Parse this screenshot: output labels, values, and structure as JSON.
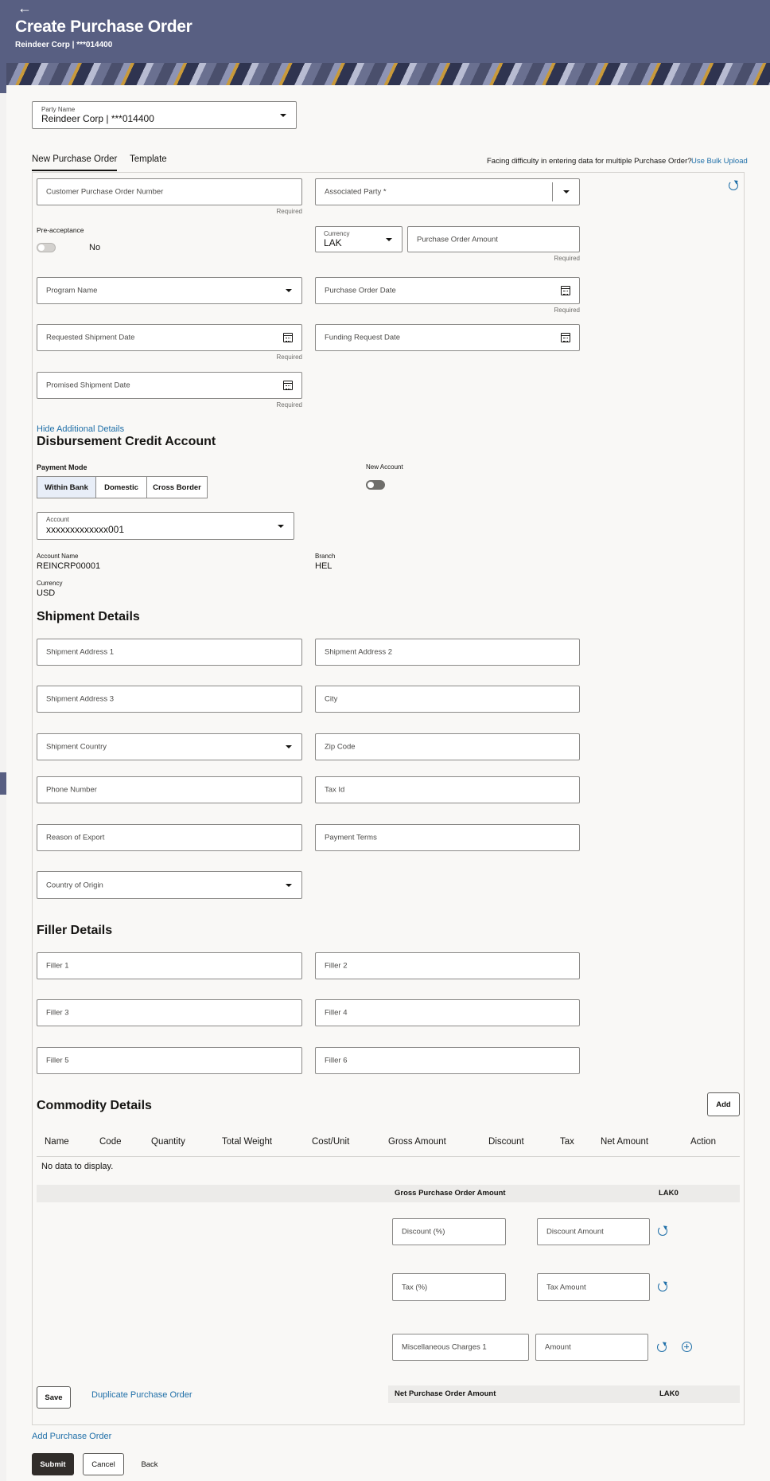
{
  "header": {
    "title": "Create Purchase Order",
    "subtitle": "Reindeer Corp | ***014400",
    "back_icon": "arrow-left-icon"
  },
  "party": {
    "label": "Party Name",
    "value": "Reindeer Corp | ***014400"
  },
  "tabs": [
    {
      "label": "New Purchase Order",
      "active": true
    },
    {
      "label": "Template",
      "active": false
    }
  ],
  "bulk": {
    "text": "Facing difficulty in entering data for multiple Purchase Order?",
    "link": "Use Bulk Upload"
  },
  "form": {
    "customer_po_number": "Customer Purchase Order Number",
    "associated_party": "Associated Party  *",
    "required": "Required",
    "pre_acceptance": {
      "label": "Pre-acceptance",
      "value": "No"
    },
    "currency": {
      "label": "Currency",
      "value": "LAK"
    },
    "po_amount": "Purchase Order Amount",
    "program_name": "Program Name",
    "po_date": "Purchase Order Date",
    "requested_shipment_date": "Requested Shipment Date",
    "funding_request_date": "Funding Request Date",
    "promised_shipment_date": "Promised Shipment Date",
    "hide_additional": "Hide Additional Details"
  },
  "disbursement": {
    "title": "Disbursement Credit Account",
    "payment_mode_label": "Payment Mode",
    "modes": [
      "Within Bank",
      "Domestic",
      "Cross Border"
    ],
    "new_account_label": "New Account",
    "account": {
      "label": "Account",
      "value": "xxxxxxxxxxxxx001"
    },
    "account_name": {
      "label": "Account Name",
      "value": "REINCRP00001"
    },
    "branch": {
      "label": "Branch",
      "value": "HEL"
    },
    "currency": {
      "label": "Currency",
      "value": "USD"
    }
  },
  "shipment": {
    "title": "Shipment Details",
    "address1": "Shipment Address 1",
    "address2": "Shipment Address 2",
    "address3": "Shipment Address 3",
    "city": "City",
    "country": "Shipment Country",
    "zip": "Zip Code",
    "phone": "Phone Number",
    "tax_id": "Tax Id",
    "reason_export": "Reason of Export",
    "payment_terms": "Payment Terms",
    "country_origin": "Country of Origin"
  },
  "filler": {
    "title": "Filler Details",
    "fields": [
      "Filler 1",
      "Filler 2",
      "Filler 3",
      "Filler 4",
      "Filler 5",
      "Filler 6"
    ]
  },
  "commodity": {
    "title": "Commodity Details",
    "add_button": "Add",
    "columns": [
      "Name",
      "Code",
      "Quantity",
      "Total Weight",
      "Cost/Unit",
      "Gross Amount",
      "Discount",
      "Tax",
      "Net Amount",
      "Action"
    ],
    "empty": "No data to display.",
    "gross_label": "Gross Purchase Order Amount",
    "gross_value": "LAK0",
    "discount_pct": "Discount (%)",
    "discount_amount": "Discount Amount",
    "tax_pct": "Tax (%)",
    "tax_amount": "Tax Amount",
    "misc_charges": "Miscellaneous Charges 1",
    "misc_amount": "Amount",
    "net_label": "Net Purchase Order Amount",
    "net_value": "LAK0"
  },
  "actions": {
    "save": "Save",
    "duplicate": "Duplicate Purchase Order",
    "add_po": "Add Purchase Order",
    "submit": "Submit",
    "cancel": "Cancel",
    "back": "Back"
  }
}
